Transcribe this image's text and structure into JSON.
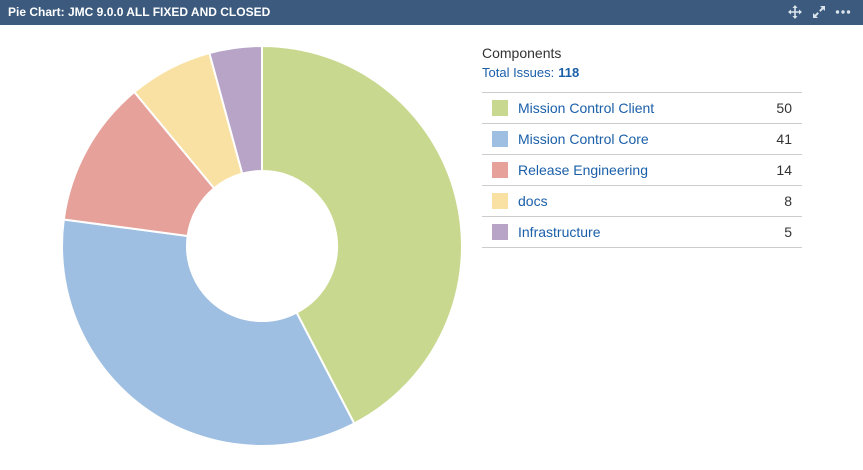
{
  "gadget": {
    "title": "Pie Chart: JMC 9.0.0 ALL FIXED AND CLOSED",
    "actions": [
      {
        "icon": "move-icon"
      },
      {
        "icon": "maximize-icon"
      },
      {
        "icon": "more-options-icon"
      }
    ]
  },
  "legend": {
    "heading": "Components",
    "total_label": "Total Issues:",
    "total_value": "118"
  },
  "chart_data": {
    "type": "pie",
    "donut": true,
    "categories": [
      "Mission Control Client",
      "Mission Control Core",
      "Release Engineering",
      "docs",
      "Infrastructure"
    ],
    "values": [
      50,
      41,
      14,
      8,
      5
    ],
    "colors": [
      "#c8d98f",
      "#9fbfe2",
      "#e6a19a",
      "#f9e1a3",
      "#b7a4c6"
    ],
    "legend_position": "right"
  }
}
